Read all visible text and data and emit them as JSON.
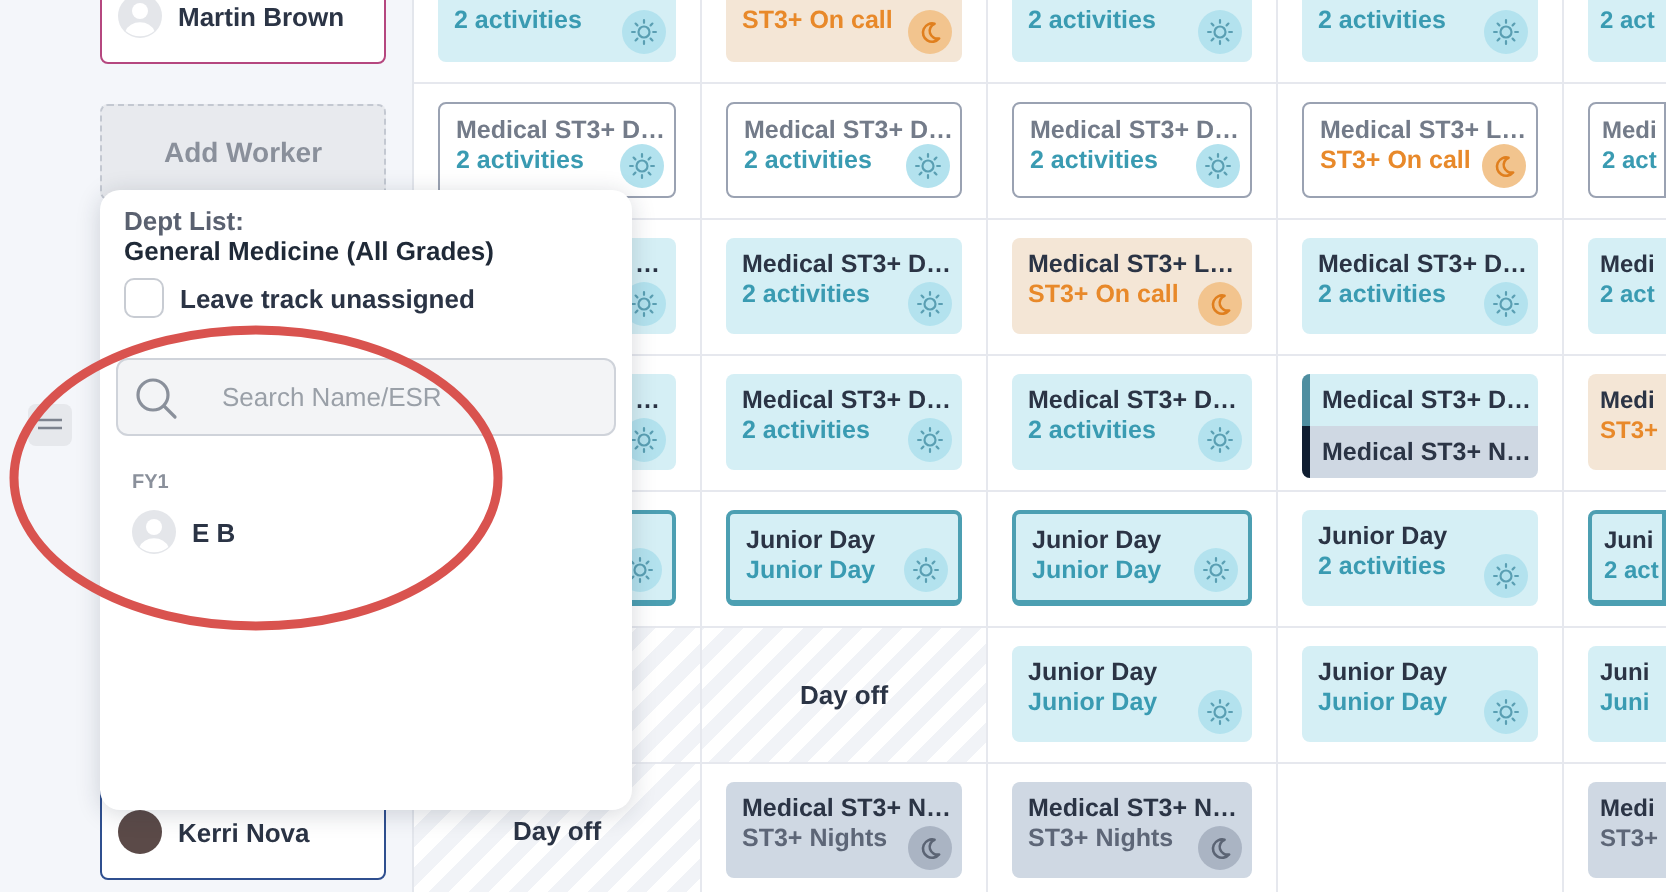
{
  "rows": [
    {
      "worker": {
        "kind": "person",
        "name": "Martin Brown",
        "has_photo": false,
        "color": "#b5477f"
      },
      "cells": [
        {
          "kind": "day",
          "draft": false,
          "highlighted": false,
          "obscured": false,
          "subtitle": "2 activities"
        },
        {
          "kind": "oncall",
          "draft": false,
          "highlighted": false,
          "obscured": false,
          "subtitle": "ST3+ On call"
        },
        {
          "kind": "day",
          "draft": false,
          "highlighted": false,
          "obscured": false,
          "subtitle": "2 activities"
        },
        {
          "kind": "day",
          "draft": false,
          "highlighted": false,
          "obscured": false,
          "subtitle": "2 activities"
        },
        {
          "kind": "day",
          "draft": false,
          "highlighted": false,
          "obscured": false,
          "subtitle": "2 act"
        }
      ]
    },
    {
      "worker": {
        "kind": "add",
        "label": "Add Worker"
      },
      "cells": [
        {
          "kind": "day",
          "draft": true,
          "highlighted": false,
          "obscured": false,
          "title": "Medical ST3+ D…",
          "subtitle": "2 activities"
        },
        {
          "kind": "day",
          "draft": true,
          "highlighted": false,
          "obscured": false,
          "title": "Medical ST3+ D…",
          "subtitle": "2 activities"
        },
        {
          "kind": "day",
          "draft": true,
          "highlighted": false,
          "obscured": false,
          "title": "Medical ST3+ D…",
          "subtitle": "2 activities"
        },
        {
          "kind": "oncall",
          "draft": true,
          "highlighted": false,
          "obscured": false,
          "title": "Medical ST3+ L…",
          "subtitle": "ST3+ On call"
        },
        {
          "kind": "day",
          "draft": true,
          "highlighted": false,
          "obscured": false,
          "title": "Medi",
          "subtitle": "2 act"
        }
      ]
    },
    {
      "worker": {
        "kind": "none"
      },
      "cells": [
        {
          "kind": "day",
          "draft": false,
          "highlighted": false,
          "obscured": true,
          "title": "…"
        },
        {
          "kind": "day",
          "draft": false,
          "highlighted": false,
          "obscured": false,
          "title": "Medical ST3+ D…",
          "subtitle": "2 activities"
        },
        {
          "kind": "oncall",
          "draft": false,
          "highlighted": false,
          "obscured": false,
          "title": "Medical ST3+ L…",
          "subtitle": "ST3+ On call"
        },
        {
          "kind": "day",
          "draft": false,
          "highlighted": false,
          "obscured": false,
          "title": "Medical ST3+ D…",
          "subtitle": "2 activities"
        },
        {
          "kind": "day",
          "draft": false,
          "highlighted": false,
          "obscured": false,
          "title": "Medi",
          "subtitle": "2 act"
        }
      ]
    },
    {
      "worker": {
        "kind": "handle"
      },
      "cells": [
        {
          "kind": "day",
          "draft": false,
          "highlighted": false,
          "obscured": true,
          "title": "…"
        },
        {
          "kind": "day",
          "draft": false,
          "highlighted": false,
          "obscured": false,
          "title": "Medical ST3+ D…",
          "subtitle": "2 activities"
        },
        {
          "kind": "day",
          "draft": false,
          "highlighted": false,
          "obscured": false,
          "title": "Medical ST3+ D…",
          "subtitle": "2 activities"
        },
        {
          "kind": "split",
          "parts": [
            {
              "kind": "day",
              "title": "Medical ST3+ D…"
            },
            {
              "kind": "night",
              "title": "Medical ST3+ N…"
            }
          ]
        },
        {
          "kind": "oncall",
          "draft": false,
          "highlighted": false,
          "obscured": false,
          "title": "Medi",
          "subtitle": "ST3+"
        }
      ]
    },
    {
      "worker": {
        "kind": "none"
      },
      "cells": [
        {
          "kind": "day",
          "draft": false,
          "highlighted": true,
          "obscured": true
        },
        {
          "kind": "day",
          "draft": false,
          "highlighted": true,
          "obscured": false,
          "title": "Junior Day",
          "subtitle": "Junior Day"
        },
        {
          "kind": "day",
          "draft": false,
          "highlighted": true,
          "obscured": false,
          "title": "Junior Day",
          "subtitle": "Junior Day"
        },
        {
          "kind": "day",
          "draft": false,
          "highlighted": false,
          "obscured": false,
          "title": "Junior Day",
          "subtitle": "2 activities"
        },
        {
          "kind": "day",
          "draft": false,
          "highlighted": true,
          "obscured": false,
          "title": "Juni",
          "subtitle": "2 act"
        }
      ]
    },
    {
      "worker": {
        "kind": "none"
      },
      "cells": [
        {
          "kind": "off"
        },
        {
          "kind": "off",
          "label": "Day off"
        },
        {
          "kind": "day",
          "draft": false,
          "highlighted": false,
          "obscured": false,
          "title": "Junior Day",
          "subtitle": "Junior Day"
        },
        {
          "kind": "day",
          "draft": false,
          "highlighted": false,
          "obscured": false,
          "title": "Junior Day",
          "subtitle": "Junior Day"
        },
        {
          "kind": "day",
          "draft": false,
          "highlighted": false,
          "obscured": false,
          "title": "Juni",
          "subtitle": "Juni"
        }
      ]
    },
    {
      "worker": {
        "kind": "person",
        "name": "Kerri Nova",
        "has_photo": true,
        "color": "#2f4f8f"
      },
      "cells": [
        {
          "kind": "off",
          "label": "Day off"
        },
        {
          "kind": "night",
          "draft": false,
          "highlighted": false,
          "obscured": false,
          "title": "Medical ST3+ N…",
          "subtitle": "ST3+ Nights"
        },
        {
          "kind": "night",
          "draft": false,
          "highlighted": false,
          "obscured": false,
          "title": "Medical ST3+ N…",
          "subtitle": "ST3+ Nights"
        },
        {
          "kind": "empty"
        },
        {
          "kind": "night",
          "draft": false,
          "highlighted": false,
          "obscured": false,
          "title": "Medi",
          "subtitle": "ST3+"
        }
      ]
    }
  ],
  "popup": {
    "heading": "Dept List:",
    "department": "General Medicine (All Grades)",
    "checkbox": {
      "label": "Leave track unassigned",
      "checked": false
    },
    "search": {
      "placeholder": "Search Name/ESR"
    },
    "groups": [
      {
        "label": "FY1",
        "people": [
          {
            "name": "E B"
          }
        ]
      }
    ]
  }
}
